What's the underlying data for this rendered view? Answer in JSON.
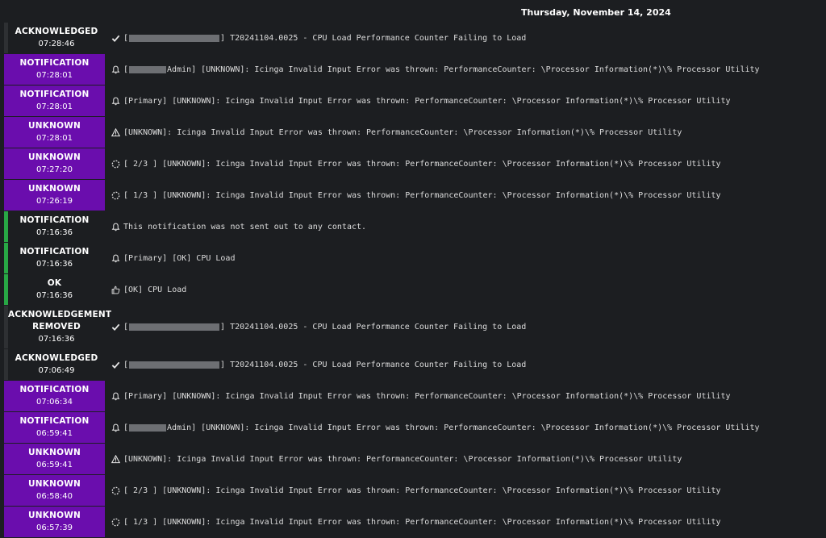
{
  "date_header": "Thursday, November 14, 2024",
  "colors": {
    "notification_bg": "#6a0dad",
    "ok_bar": "#28a745",
    "background": "#1c1e21"
  },
  "events": [
    {
      "state": "ACKNOWLEDGED",
      "time": "07:28:46",
      "icon": "check-icon",
      "prefix": "[",
      "redacted": true,
      "suffix": "] T20241104.0025 - CPU Load Performance Counter Failing to Load",
      "style": "gray"
    },
    {
      "state": "NOTIFICATION",
      "time": "07:28:01",
      "icon": "bell-icon",
      "prefix": "[",
      "redacted": true,
      "suffix": "Admin] [UNKNOWN]: Icinga Invalid Input Error was thrown: PerformanceCounter: \\Processor Information(*)\\% Processor Utility",
      "style": "purple"
    },
    {
      "state": "NOTIFICATION",
      "time": "07:28:01",
      "icon": "bell-icon",
      "prefix": "[Primary] [UNKNOWN]: Icinga Invalid Input Error was thrown: PerformanceCounter: \\Processor Information(*)\\% Processor Utility",
      "redacted": false,
      "suffix": "",
      "style": "purple"
    },
    {
      "state": "UNKNOWN",
      "time": "07:28:01",
      "icon": "warning-icon",
      "prefix": "[UNKNOWN]: Icinga Invalid Input Error was thrown: PerformanceCounter: \\Processor Information(*)\\% Processor Utility",
      "redacted": false,
      "suffix": "",
      "style": "purple"
    },
    {
      "state": "UNKNOWN",
      "time": "07:27:20",
      "icon": "spinner-icon",
      "prefix": "[ 2/3 ] [UNKNOWN]: Icinga Invalid Input Error was thrown: PerformanceCounter: \\Processor Information(*)\\% Processor Utility",
      "redacted": false,
      "suffix": "",
      "style": "purple"
    },
    {
      "state": "UNKNOWN",
      "time": "07:26:19",
      "icon": "spinner-icon",
      "prefix": "[ 1/3 ] [UNKNOWN]: Icinga Invalid Input Error was thrown: PerformanceCounter: \\Processor Information(*)\\% Processor Utility",
      "redacted": false,
      "suffix": "",
      "style": "purple"
    },
    {
      "state": "NOTIFICATION",
      "time": "07:16:36",
      "icon": "bell-icon",
      "prefix": "This notification was not sent out to any contact.",
      "redacted": false,
      "suffix": "",
      "style": "green"
    },
    {
      "state": "NOTIFICATION",
      "time": "07:16:36",
      "icon": "bell-icon",
      "prefix": "[Primary] [OK] CPU Load",
      "redacted": false,
      "suffix": "",
      "style": "green"
    },
    {
      "state": "OK",
      "time": "07:16:36",
      "icon": "thumbs-up-icon",
      "prefix": "[OK] CPU Load",
      "redacted": false,
      "suffix": "",
      "style": "green"
    },
    {
      "state": "ACKNOWLEDGEMENT REMOVED",
      "state_line1": "ACKNOWLEDGEMENT",
      "state_line2": "REMOVED",
      "time": "07:16:36",
      "icon": "check-icon",
      "prefix": "[",
      "redacted": true,
      "suffix": "] T20241104.0025 - CPU Load Performance Counter Failing to Load",
      "style": "gray",
      "tall": true
    },
    {
      "state": "ACKNOWLEDGED",
      "time": "07:06:49",
      "icon": "check-icon",
      "prefix": "[",
      "redacted": true,
      "suffix": "] T20241104.0025 - CPU Load Performance Counter Failing to Load",
      "style": "gray"
    },
    {
      "state": "NOTIFICATION",
      "time": "07:06:34",
      "icon": "bell-icon",
      "prefix": "[Primary] [UNKNOWN]: Icinga Invalid Input Error was thrown: PerformanceCounter: \\Processor Information(*)\\% Processor Utility",
      "redacted": false,
      "suffix": "",
      "style": "purple"
    },
    {
      "state": "NOTIFICATION",
      "time": "06:59:41",
      "icon": "bell-icon",
      "prefix": "[",
      "redacted": true,
      "suffix": "Admin] [UNKNOWN]: Icinga Invalid Input Error was thrown: PerformanceCounter: \\Processor Information(*)\\% Processor Utility",
      "style": "purple"
    },
    {
      "state": "UNKNOWN",
      "time": "06:59:41",
      "icon": "warning-icon",
      "prefix": "[UNKNOWN]: Icinga Invalid Input Error was thrown: PerformanceCounter: \\Processor Information(*)\\% Processor Utility",
      "redacted": false,
      "suffix": "",
      "style": "purple"
    },
    {
      "state": "UNKNOWN",
      "time": "06:58:40",
      "icon": "spinner-icon",
      "prefix": "[ 2/3 ] [UNKNOWN]: Icinga Invalid Input Error was thrown: PerformanceCounter: \\Processor Information(*)\\% Processor Utility",
      "redacted": false,
      "suffix": "",
      "style": "purple"
    },
    {
      "state": "UNKNOWN",
      "time": "06:57:39",
      "icon": "spinner-icon",
      "prefix": "[ 1/3 ] [UNKNOWN]: Icinga Invalid Input Error was thrown: PerformanceCounter: \\Processor Information(*)\\% Processor Utility",
      "redacted": false,
      "suffix": "",
      "style": "purple"
    }
  ]
}
